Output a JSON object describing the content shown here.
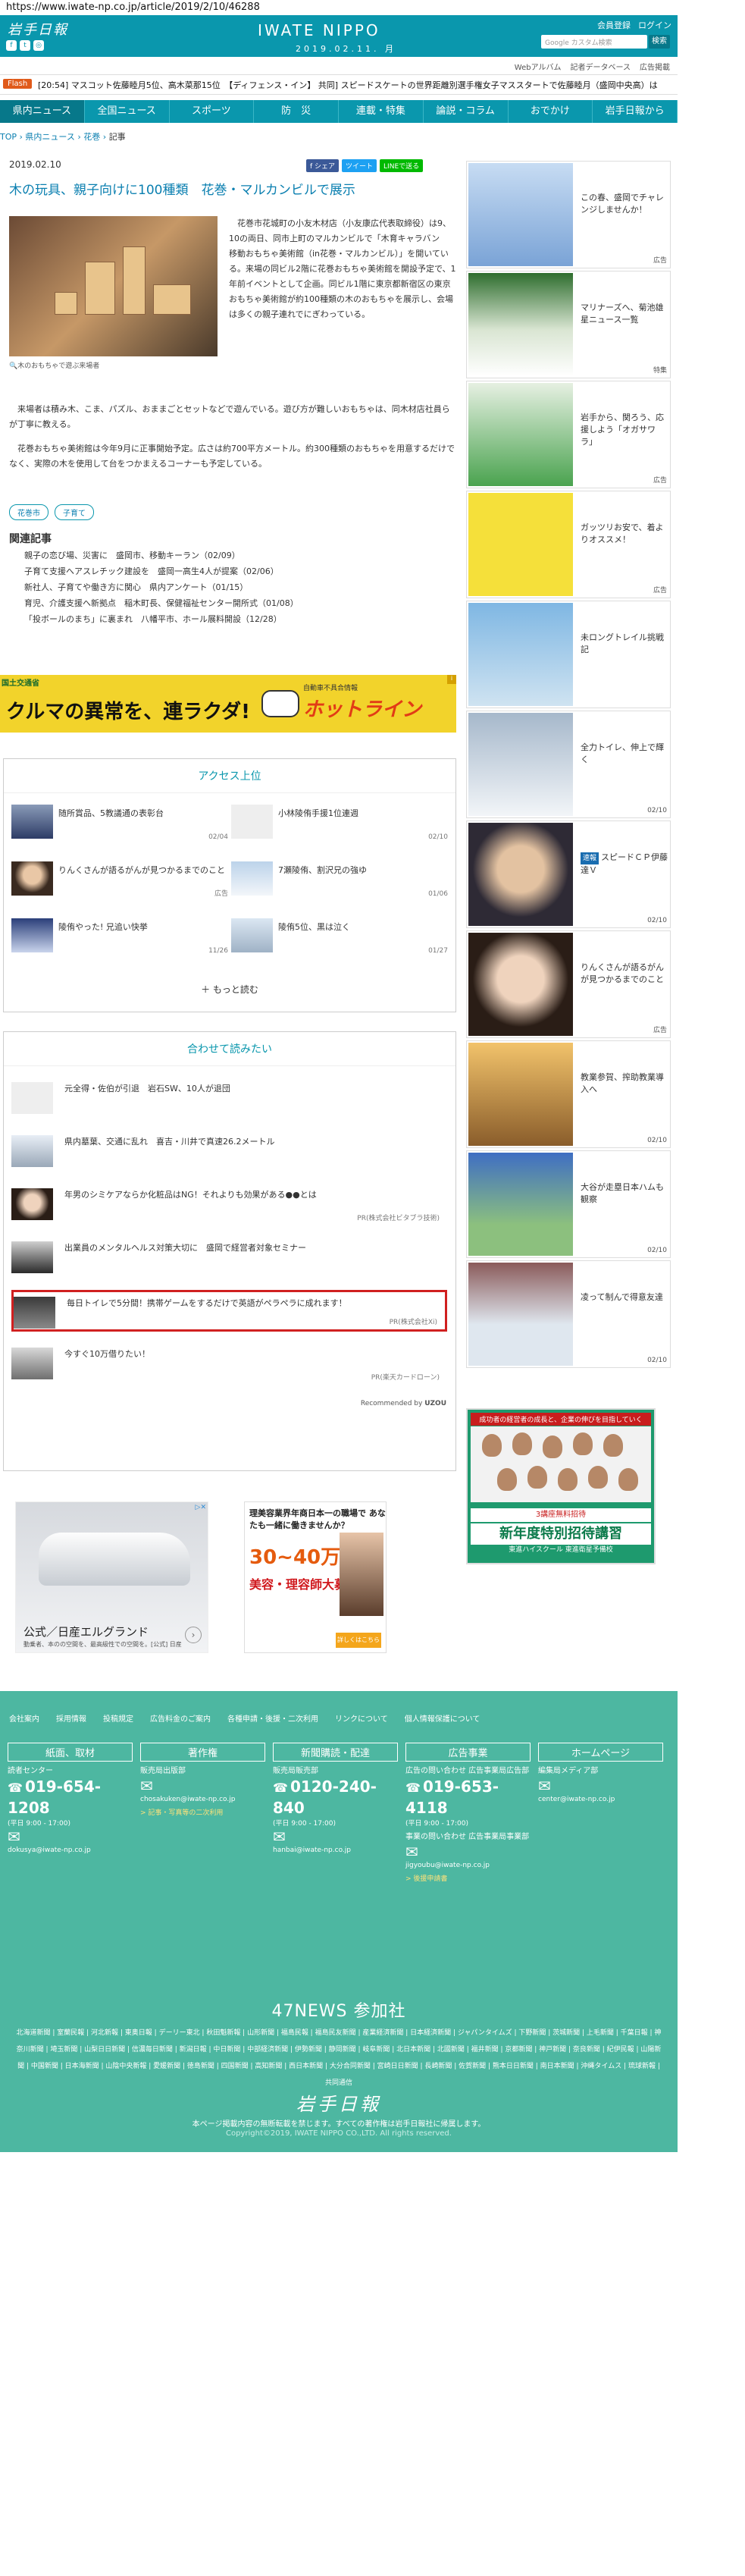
{
  "url": "https://www.iwate-np.co.jp/article/2019/2/10/46288",
  "header": {
    "logo_jp": "岩手日報",
    "logo_en": "IWATE NIPPO",
    "date": "2019.02.11. 月",
    "member_register": "会員登録",
    "login": "ログイン",
    "search_placeholder": "Google カスタム検索",
    "search_button": "検索",
    "sub_links": [
      "Webアルバム",
      "記者データベース",
      "広告掲載"
    ],
    "flash_label": "Flash",
    "ticker": "[20:54] マスコット佐藤睦月5位、高木菜那15位　【ディフェンス・イン】 共同] スピードスケートの世界距離別選手権女子マススタートで佐藤睦月（盛岡中央高）は"
  },
  "nav": [
    "県内ニュース",
    "全国ニュース",
    "スポーツ",
    "防　災",
    "連載・特集",
    "論説・コラム",
    "おでかけ",
    "岩手日報から"
  ],
  "breadcrumb": {
    "top": "TOP",
    "sep": " › ",
    "c1": "県内ニュース",
    "c2": "花巻",
    "c3": "記事"
  },
  "article": {
    "date": "2019.02.10",
    "share_fb": "f シェア",
    "share_tw": "ツイート",
    "share_line": "LINEで送る",
    "title": "木の玩具、親子向けに100種類　花巻・マルカンビルで展示",
    "photo_caption": "木のおもちゃで遊ぶ来場者",
    "lead": "花巻市花城町の小友木材店（小友康広代表取締役）は9、10の両日、同市上町のマルカンビルで「木育キャラバン　移動おもちゃ美術館（in花巻・マルカンビル）」を開いている。来場の同ビル2階に花巻おもちゃ美術館を開設予定で、1年前イベントとして企画。同ビル1階に東京都新宿区の東京おもちゃ美術館が約100種類の木のおもちゃを展示し、会場は多くの親子連れでにぎわっている。",
    "body1": "来場者は積み木、こま、パズル、おままごとセットなどで遊んでいる。遊び方が難しいおもちゃは、同木材店社員らが丁寧に教える。",
    "body2": "花巻おもちゃ美術館は今年9月に正事開始予定。広さは約700平方メートル。約300種類のおもちゃを用意するだけでなく、実際の木を使用して台をつかまえるコーナーも予定している。",
    "tags": [
      "花巻市",
      "子育て"
    ],
    "related_heading": "関連記事",
    "related": [
      "親子の恋び場、災害に　盛岡市、移動キーラン（02/09）",
      "子育て支援へアスレチック建設を　盛岡一高生4人が提案（02/06）",
      "新社人、子育てや働き方に関心　県内アンケート（01/15）",
      "育児、介護支援へ新拠点　稲木町長、保健福祉センター開所式（01/08）",
      "「投ボールのまち」に裏まれ　八幡平市、ホール展料開設（12/28）"
    ]
  },
  "ad_banner": {
    "sponsor": "国土交通省",
    "headline": "クルマの異常を、連ラクダ!",
    "brand": "ホットライン",
    "sub": "自動車不具合情報"
  },
  "ranking": {
    "heading": "アクセス上位",
    "items": [
      {
        "title": "随所賞品、5教議通の表彰台",
        "date": "02/04"
      },
      {
        "title": "小林陵侑手援1位連週",
        "date": "02/10"
      },
      {
        "title": "りんくさんが語るがんが見つかるまでのこと",
        "date": "広告"
      },
      {
        "title": "7瀬陵侑、割沢兄の強ゆ",
        "date": "01/06"
      },
      {
        "title": "陵侑やった! 兄追い快挙",
        "date": "11/26"
      },
      {
        "title": "陵侑5位、黒は泣く",
        "date": "01/27"
      }
    ],
    "more": "もっと読む"
  },
  "recommend": {
    "heading": "合わせて読みたい",
    "items": [
      {
        "title": "元全得・佐伯が引退　岩石SW、10人が退団",
        "pr": ""
      },
      {
        "title": "県内墓葉、交通に乱れ　喜吉・川井で真速26.2メートル",
        "pr": ""
      },
      {
        "title": "年男のシミケアならか化粧品はNG！それよりも効果がある●●とは",
        "pr": "PR(株式会社ビタブラ技術)"
      },
      {
        "title": "出業員のメンタルヘルス対策大切に　盛岡で経営者対象セミナー",
        "pr": ""
      },
      {
        "title": "毎日トイレで5分間！携帯ゲームをするだけで英語がペラペラに成れます！",
        "pr": "PR(株式会社Xi)"
      },
      {
        "title": "今すぐ10万借りたい！",
        "pr": "PR(楽天カードローン)"
      }
    ],
    "by": "Recommended by",
    "by_brand": "UZOU"
  },
  "ad_car": {
    "title": "公式／日産エルグランド",
    "sub": "動乗者、本のの空間を、最高級性での空間を。[公式] 日産"
  },
  "ad_job": {
    "title": "理美容業界年商日本一の職場で あなたも一緒に働きませんか？",
    "big": "30~40万",
    "big2": "美容・理容師大募集!!",
    "btn": "詳しくはこちら"
  },
  "sidebar": [
    {
      "title": "この春、盛岡でチャレンジしませんか！",
      "tag": "",
      "label": "広告"
    },
    {
      "title": "マリナーズへ、菊池雄星ニュース一覧",
      "tag": "",
      "label": "特集"
    },
    {
      "title": "岩手から、関ろう、応援しよう「オガサワラ」",
      "tag": "",
      "label": "広告"
    },
    {
      "title": "ガッツリお安で、着よりオススメ！",
      "tag": "",
      "label": "広告"
    },
    {
      "title": "未ロングトレイル挑戦記",
      "tag": "",
      "label": ""
    },
    {
      "title": "全力トイレ、伸上で輝く",
      "tag": "",
      "label": "02/10"
    },
    {
      "title": "スピードＣＰ伊藤達Ｖ",
      "tag": "速報",
      "label": "02/10"
    },
    {
      "title": "りんくさんが語るがんが見つかるまでのこと",
      "tag": "",
      "label": "広告"
    },
    {
      "title": "教業参賀、搾助教業導入へ",
      "tag": "",
      "label": "02/10"
    },
    {
      "title": "大谷が走塁日本ハムも観察",
      "tag": "",
      "label": "02/10"
    },
    {
      "title": "凌って制んで得意友達",
      "tag": "",
      "label": "02/10"
    }
  ],
  "side_ad": {
    "head": "成功者の経営者の成長と、企業の伸びを目指していく",
    "banner": "3講座無料招待",
    "big": "新年度特別招待講習",
    "sm": "東進ハイスクール 東進衛星予備校"
  },
  "footer": {
    "links": [
      "会社案内",
      "採用情報",
      "投稿規定",
      "広告料金のご案内",
      "各種申請・後援・二次利用",
      "リンクについて",
      "個人情報保護について"
    ],
    "cols": [
      {
        "head": "紙面、取材",
        "sub": "読者センター",
        "phone": "019-654-1208",
        "time": "(平日 9:00 - 17:00)",
        "mail": "dokusya@iwate-np.co.jp",
        "link": ""
      },
      {
        "head": "著作権",
        "sub": "販売局出版部",
        "phone": "",
        "time": "",
        "mail": "chosakuken@iwate-np.co.jp",
        "link": "> 記事・写真等の二次利用"
      },
      {
        "head": "新聞購読・配達",
        "sub": "販売局販売部",
        "phone": "0120-240-840",
        "time": "(平日 9:00 - 17:00)",
        "mail": "hanbai@iwate-np.co.jp",
        "link": ""
      },
      {
        "head": "広告事業",
        "sub": "広告の問い合わせ 広告事業局広告部",
        "phone": "019-653-4118",
        "time": "(平日 9:00 - 17:00)",
        "mail": "jigyoubu@iwate-np.co.jp",
        "link": "> 後援申請書"
      },
      {
        "head": "ホームページ",
        "sub": "編集局メディア部",
        "phone": "",
        "time": "",
        "mail": "center@iwate-np.co.jp",
        "link": ""
      }
    ],
    "events_sub": "事業の問い合わせ 広告事業局事業部",
    "n47": "47NEWS 参加社",
    "n47_list": "北海道新聞 | 室蘭民報 | 河北新報 | 東奥日報 | デーリー東北 | 秋田魁新報 | 山形新聞 | 福島民報 | 福島民友新聞 | 産業経済新聞 | 日本経済新聞 | ジャパンタイムズ | 下野新聞 | 茨城新聞 | 上毛新聞 | 千葉日報 | 神奈川新聞 | 埼玉新聞 | 山梨日日新聞 | 信濃毎日新聞 | 新潟日報 | 中日新聞 | 中部経済新聞 | 伊勢新聞 | 静岡新聞 | 岐阜新聞 | 北日本新聞 | 北國新聞 | 福井新聞 | 京都新聞 | 神戸新聞 | 奈良新聞 | 紀伊民報 | 山陽新聞 | 中国新聞 | 日本海新聞 | 山陰中央新報 | 愛媛新聞 | 徳島新聞 | 四国新聞 | 高知新聞 | 西日本新聞 | 大分合同新聞 | 宮崎日日新聞 | 長崎新聞 | 佐賀新聞 | 熊本日日新聞 | 南日本新聞 | 沖縄タイムス | 琉球新報 | 共同通信",
    "logo": "岩手日報",
    "copy1": "本ページ掲載内容の無断転載を禁じます。すべての著作権は岩手日報社に帰属します。",
    "copy2": "Copyright©2019, IWATE NIPPO CO.,LTD. All rights reserved."
  }
}
